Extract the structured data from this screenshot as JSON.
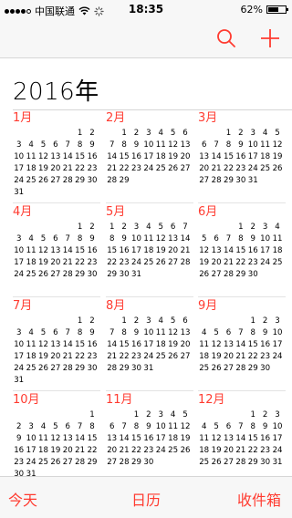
{
  "status": {
    "carrier": "中国联通",
    "time": "18:35",
    "battery": "62%",
    "battery_level": 0.62
  },
  "nav": {
    "search_icon": "search-icon",
    "add_icon": "plus-icon"
  },
  "year": "2016年",
  "colors": {
    "accent": "#ff3b30",
    "bar": "#f7f7f7"
  },
  "months": [
    {
      "name": "1月",
      "days": [
        "",
        "",
        "",
        "",
        "",
        "1",
        "2",
        "3",
        "4",
        "5",
        "6",
        "7",
        "8",
        "9",
        "10",
        "11",
        "12",
        "13",
        "14",
        "15",
        "16",
        "17",
        "18",
        "19",
        "20",
        "21",
        "22",
        "23",
        "24",
        "25",
        "26",
        "27",
        "28",
        "29",
        "30",
        "31"
      ]
    },
    {
      "name": "2月",
      "days": [
        "",
        "1",
        "2",
        "3",
        "4",
        "5",
        "6",
        "7",
        "8",
        "9",
        "10",
        "11",
        "12",
        "13",
        "14",
        "15",
        "16",
        "17",
        "18",
        "19",
        "20",
        "21",
        "22",
        "23",
        "24",
        "25",
        "26",
        "27",
        "28",
        "29"
      ]
    },
    {
      "name": "3月",
      "days": [
        "",
        "",
        "1",
        "2",
        "3",
        "4",
        "5",
        "6",
        "7",
        "8",
        "9",
        "10",
        "11",
        "12",
        "13",
        "14",
        "15",
        "16",
        "17",
        "18",
        "19",
        "20",
        "21",
        "22",
        "23",
        "24",
        "25",
        "26",
        "27",
        "28",
        "29",
        "30",
        "31"
      ]
    },
    {
      "name": "4月",
      "days": [
        "",
        "",
        "",
        "",
        "",
        "1",
        "2",
        "3",
        "4",
        "5",
        "6",
        "7",
        "8",
        "9",
        "10",
        "11",
        "12",
        "13",
        "14",
        "15",
        "16",
        "17",
        "18",
        "19",
        "20",
        "21",
        "22",
        "23",
        "24",
        "25",
        "26",
        "27",
        "28",
        "29",
        "30"
      ]
    },
    {
      "name": "5月",
      "days": [
        "1",
        "2",
        "3",
        "4",
        "5",
        "6",
        "7",
        "8",
        "9",
        "10",
        "11",
        "12",
        "13",
        "14",
        "15",
        "16",
        "17",
        "18",
        "19",
        "20",
        "21",
        "22",
        "23",
        "24",
        "25",
        "26",
        "27",
        "28",
        "29",
        "30",
        "31"
      ]
    },
    {
      "name": "6月",
      "days": [
        "",
        "",
        "",
        "1",
        "2",
        "3",
        "4",
        "5",
        "6",
        "7",
        "8",
        "9",
        "10",
        "11",
        "12",
        "13",
        "14",
        "15",
        "16",
        "17",
        "18",
        "19",
        "20",
        "21",
        "22",
        "23",
        "24",
        "25",
        "26",
        "27",
        "28",
        "29",
        "30"
      ]
    },
    {
      "name": "7月",
      "days": [
        "",
        "",
        "",
        "",
        "",
        "1",
        "2",
        "3",
        "4",
        "5",
        "6",
        "7",
        "8",
        "9",
        "10",
        "11",
        "12",
        "13",
        "14",
        "15",
        "16",
        "17",
        "18",
        "19",
        "20",
        "21",
        "22",
        "23",
        "24",
        "25",
        "26",
        "27",
        "28",
        "29",
        "30",
        "31"
      ]
    },
    {
      "name": "8月",
      "days": [
        "",
        "1",
        "2",
        "3",
        "4",
        "5",
        "6",
        "7",
        "8",
        "9",
        "10",
        "11",
        "12",
        "13",
        "14",
        "15",
        "16",
        "17",
        "18",
        "19",
        "20",
        "21",
        "22",
        "23",
        "24",
        "25",
        "26",
        "27",
        "28",
        "29",
        "30",
        "31"
      ]
    },
    {
      "name": "9月",
      "days": [
        "",
        "",
        "",
        "",
        "1",
        "2",
        "3",
        "4",
        "5",
        "6",
        "7",
        "8",
        "9",
        "10",
        "11",
        "12",
        "13",
        "14",
        "15",
        "16",
        "17",
        "18",
        "19",
        "20",
        "21",
        "22",
        "23",
        "24",
        "25",
        "26",
        "27",
        "28",
        "29",
        "30"
      ]
    },
    {
      "name": "10月",
      "days": [
        "",
        "",
        "",
        "",
        "",
        "",
        "1",
        "2",
        "3",
        "4",
        "5",
        "6",
        "7",
        "8",
        "9",
        "10",
        "11",
        "12",
        "13",
        "14",
        "15",
        "16",
        "17",
        "18",
        "19",
        "20",
        "21",
        "22",
        "23",
        "24",
        "25",
        "26",
        "27",
        "28",
        "29",
        "30",
        "31"
      ]
    },
    {
      "name": "11月",
      "days": [
        "",
        "",
        "1",
        "2",
        "3",
        "4",
        "5",
        "6",
        "7",
        "8",
        "9",
        "10",
        "11",
        "12",
        "13",
        "14",
        "15",
        "16",
        "17",
        "18",
        "19",
        "20",
        "21",
        "22",
        "23",
        "24",
        "25",
        "26",
        "27",
        "28",
        "29",
        "30"
      ]
    },
    {
      "name": "12月",
      "days": [
        "",
        "",
        "",
        "",
        "1",
        "2",
        "3",
        "4",
        "5",
        "6",
        "7",
        "8",
        "9",
        "10",
        "11",
        "12",
        "13",
        "14",
        "15",
        "16",
        "17",
        "18",
        "19",
        "20",
        "21",
        "22",
        "23",
        "24",
        "25",
        "26",
        "27",
        "28",
        "29",
        "30",
        "31"
      ]
    }
  ],
  "tabs": {
    "today": "今天",
    "calendars": "日历",
    "inbox": "收件箱"
  }
}
